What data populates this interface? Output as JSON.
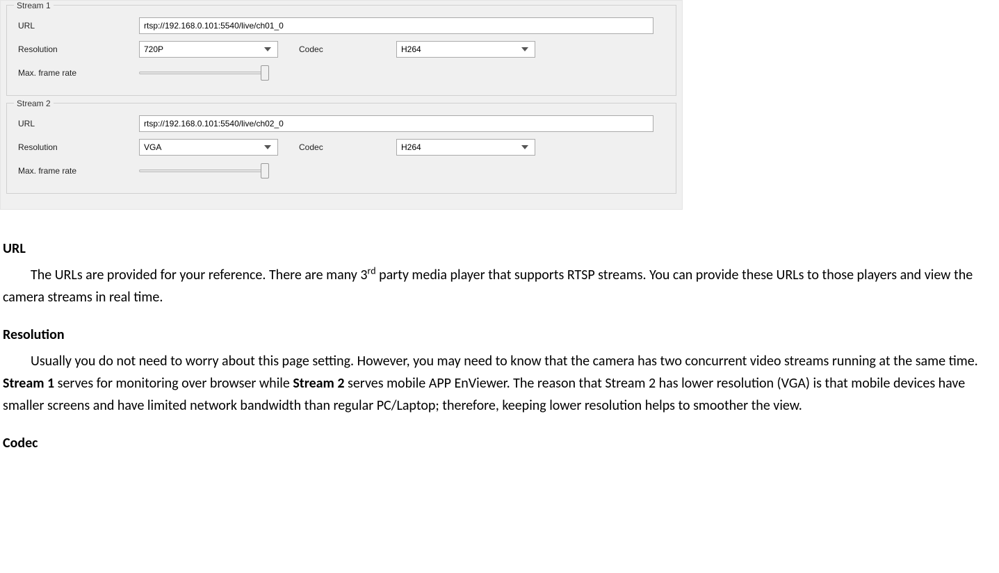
{
  "settings": {
    "streams": [
      {
        "legend": "Stream 1",
        "url_label": "URL",
        "url_value": "rtsp://192.168.0.101:5540/live/ch01_0",
        "resolution_label": "Resolution",
        "resolution_value": "720P",
        "codec_label": "Codec",
        "codec_value": "H264",
        "framerate_label": "Max. frame rate"
      },
      {
        "legend": "Stream 2",
        "url_label": "URL",
        "url_value": "rtsp://192.168.0.101:5540/live/ch02_0",
        "resolution_label": "Resolution",
        "resolution_value": "VGA",
        "codec_label": "Codec",
        "codec_value": "H264",
        "framerate_label": "Max. frame rate"
      }
    ]
  },
  "doc": {
    "url_heading": "URL",
    "url_text_a": "The URLs are provided for your reference. There are many 3",
    "url_sup": "rd",
    "url_text_b": " party media player that supports RTSP streams. You can provide these URLs to those players and view the camera streams in real time.",
    "resolution_heading": "Resolution",
    "resolution_text_a": "Usually you do not need to worry about this page setting. However, you may need to know that the camera has two concurrent video streams running at the same time. ",
    "resolution_bold_1": "Stream 1",
    "resolution_text_b": " serves for monitoring over browser while ",
    "resolution_bold_2": "Stream 2",
    "resolution_text_c": " serves mobile APP EnViewer. The reason that Stream 2 has lower resolution (VGA) is that mobile devices have smaller screens and have limited network bandwidth than regular PC/Laptop; therefore, keeping lower resolution helps to smoother the view.",
    "codec_heading": "Codec"
  }
}
